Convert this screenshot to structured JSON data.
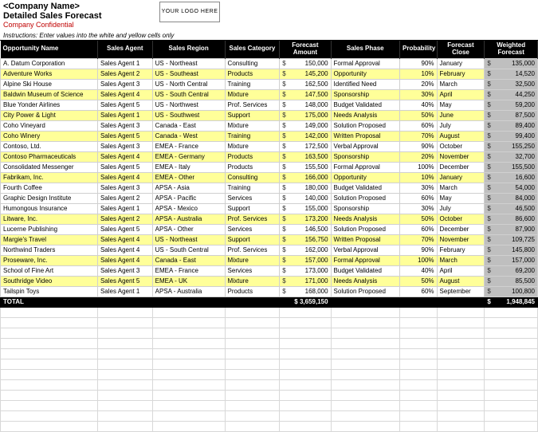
{
  "header": {
    "company": "<Company Name>",
    "title": "Detailed Sales Forecast",
    "confidential": "Company Confidential",
    "logo": "YOUR LOGO HERE",
    "instructions": "Instructions: Enter values into the white and yellow cells only"
  },
  "columns": [
    "Opportunity Name",
    "Sales Agent",
    "Sales Region",
    "Sales Category",
    "Forecast Amount",
    "Sales Phase",
    "Probability",
    "Forecast Close",
    "Weighted Forecast"
  ],
  "rows": [
    {
      "hl": false,
      "opp": "A. Datum Corporation",
      "agent": "Sales Agent 1",
      "region": "US - Northeast",
      "cat": "Consulting",
      "amt": "150,000",
      "phase": "Formal Approval",
      "prob": "90%",
      "close": "January",
      "wt": "135,000"
    },
    {
      "hl": true,
      "opp": "Adventure Works",
      "agent": "Sales Agent 2",
      "region": "US - Southeast",
      "cat": "Products",
      "amt": "145,200",
      "phase": "Opportunity",
      "prob": "10%",
      "close": "February",
      "wt": "14,520"
    },
    {
      "hl": false,
      "opp": "Alpine Ski House",
      "agent": "Sales Agent 3",
      "region": "US - North Central",
      "cat": "Training",
      "amt": "162,500",
      "phase": "Identified Need",
      "prob": "20%",
      "close": "March",
      "wt": "32,500"
    },
    {
      "hl": true,
      "opp": "Baldwin Museum of Science",
      "agent": "Sales Agent 4",
      "region": "US - South Central",
      "cat": "Mixture",
      "amt": "147,500",
      "phase": "Sponsorship",
      "prob": "30%",
      "close": "April",
      "wt": "44,250"
    },
    {
      "hl": false,
      "opp": "Blue Yonder Airlines",
      "agent": "Sales Agent 5",
      "region": "US - Northwest",
      "cat": "Prof. Services",
      "amt": "148,000",
      "phase": "Budget Validated",
      "prob": "40%",
      "close": "May",
      "wt": "59,200"
    },
    {
      "hl": true,
      "opp": "City Power & Light",
      "agent": "Sales Agent 1",
      "region": "US - Southwest",
      "cat": "Support",
      "amt": "175,000",
      "phase": "Needs Analysis",
      "prob": "50%",
      "close": "June",
      "wt": "87,500"
    },
    {
      "hl": false,
      "opp": "Coho Vineyard",
      "agent": "Sales Agent 3",
      "region": "Canada - East",
      "cat": "Mixture",
      "amt": "149,000",
      "phase": "Solution Proposed",
      "prob": "60%",
      "close": "July",
      "wt": "89,400"
    },
    {
      "hl": true,
      "opp": "Coho Winery",
      "agent": "Sales Agent 5",
      "region": "Canada - West",
      "cat": "Training",
      "amt": "142,000",
      "phase": "Written Proposal",
      "prob": "70%",
      "close": "August",
      "wt": "99,400"
    },
    {
      "hl": false,
      "opp": "Contoso, Ltd.",
      "agent": "Sales Agent 3",
      "region": "EMEA - France",
      "cat": "Mixture",
      "amt": "172,500",
      "phase": "Verbal Approval",
      "prob": "90%",
      "close": "October",
      "wt": "155,250"
    },
    {
      "hl": true,
      "opp": "Contoso Pharmaceuticals",
      "agent": "Sales Agent 4",
      "region": "EMEA - Germany",
      "cat": "Products",
      "amt": "163,500",
      "phase": "Sponsorship",
      "prob": "20%",
      "close": "November",
      "wt": "32,700"
    },
    {
      "hl": false,
      "opp": "Consolidated Messenger",
      "agent": "Sales Agent 5",
      "region": "EMEA - Italy",
      "cat": "Products",
      "amt": "155,500",
      "phase": "Formal Approval",
      "prob": "100%",
      "close": "December",
      "wt": "155,500"
    },
    {
      "hl": true,
      "opp": "Fabrikam, Inc.",
      "agent": "Sales Agent 4",
      "region": "EMEA - Other",
      "cat": "Consulting",
      "amt": "166,000",
      "phase": "Opportunity",
      "prob": "10%",
      "close": "January",
      "wt": "16,600"
    },
    {
      "hl": false,
      "opp": "Fourth Coffee",
      "agent": "Sales Agent 3",
      "region": "APSA - Asia",
      "cat": "Training",
      "amt": "180,000",
      "phase": "Budget Validated",
      "prob": "30%",
      "close": "March",
      "wt": "54,000"
    },
    {
      "hl": false,
      "opp": "Graphic Design Institute",
      "agent": "Sales Agent 2",
      "region": "APSA - Pacific",
      "cat": "Services",
      "amt": "140,000",
      "phase": "Solution Proposed",
      "prob": "60%",
      "close": "May",
      "wt": "84,000"
    },
    {
      "hl": false,
      "opp": "Humongous Insurance",
      "agent": "Sales Agent 1",
      "region": "APSA - Mexico",
      "cat": "Support",
      "amt": "155,000",
      "phase": "Sponsorship",
      "prob": "30%",
      "close": "July",
      "wt": "46,500"
    },
    {
      "hl": true,
      "opp": "Litware, Inc.",
      "agent": "Sales Agent 2",
      "region": "APSA - Australia",
      "cat": "Prof. Services",
      "amt": "173,200",
      "phase": "Needs Analysis",
      "prob": "50%",
      "close": "October",
      "wt": "86,600"
    },
    {
      "hl": false,
      "opp": "Lucerne Publishing",
      "agent": "Sales Agent 5",
      "region": "APSA - Other",
      "cat": "Services",
      "amt": "146,500",
      "phase": "Solution Proposed",
      "prob": "60%",
      "close": "December",
      "wt": "87,900"
    },
    {
      "hl": true,
      "opp": "Margie's Travel",
      "agent": "Sales Agent 4",
      "region": "US - Northeast",
      "cat": "Support",
      "amt": "156,750",
      "phase": "Written Proposal",
      "prob": "70%",
      "close": "November",
      "wt": "109,725"
    },
    {
      "hl": false,
      "opp": "Northwind Traders",
      "agent": "Sales Agent 4",
      "region": "US - South Central",
      "cat": "Prof. Services",
      "amt": "162,000",
      "phase": "Verbal Approval",
      "prob": "90%",
      "close": "February",
      "wt": "145,800"
    },
    {
      "hl": true,
      "opp": "Proseware, Inc.",
      "agent": "Sales Agent 4",
      "region": "Canada - East",
      "cat": "Mixture",
      "amt": "157,000",
      "phase": "Formal Approval",
      "prob": "100%",
      "close": "March",
      "wt": "157,000"
    },
    {
      "hl": false,
      "opp": "School of Fine Art",
      "agent": "Sales Agent 3",
      "region": "EMEA - France",
      "cat": "Services",
      "amt": "173,000",
      "phase": "Budget Validated",
      "prob": "40%",
      "close": "April",
      "wt": "69,200"
    },
    {
      "hl": true,
      "opp": "Southridge Video",
      "agent": "Sales Agent 5",
      "region": "EMEA - UK",
      "cat": "Mixture",
      "amt": "171,000",
      "phase": "Needs Analysis",
      "prob": "50%",
      "close": "August",
      "wt": "85,500"
    },
    {
      "hl": false,
      "opp": "Tailspin Toys",
      "agent": "Sales Agent 1",
      "region": "APSA - Australia",
      "cat": "Products",
      "amt": "168,000",
      "phase": "Solution Proposed",
      "prob": "60%",
      "close": "September",
      "wt": "100,800"
    }
  ],
  "total": {
    "label": "TOTAL",
    "amt": "$ 3,659,150",
    "wt": "1,948,845"
  }
}
